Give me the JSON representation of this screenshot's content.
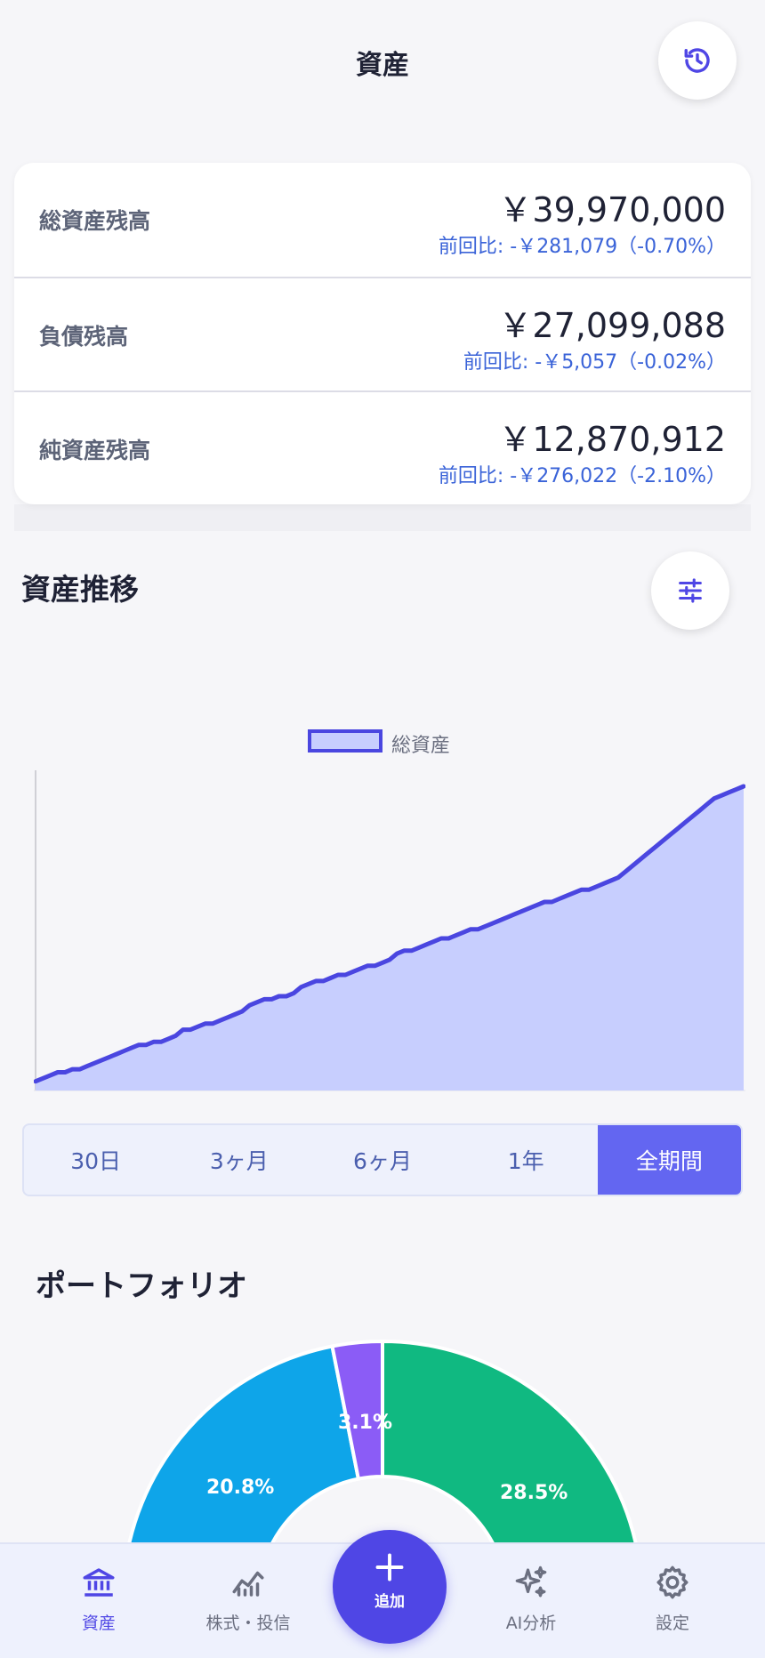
{
  "header": {
    "title": "資産"
  },
  "summary": {
    "rows": [
      {
        "label": "総資産残高",
        "value": "￥39,970,000",
        "change": "前回比: -￥281,079（-0.70%）"
      },
      {
        "label": "負債残高",
        "value": "￥27,099,088",
        "change": "前回比: -￥5,057（-0.02%）"
      },
      {
        "label": "純資産残高",
        "value": "￥12,870,912",
        "change": "前回比: -￥276,022（-2.10%）"
      }
    ]
  },
  "trend": {
    "title": "資産推移",
    "legend_label": "総資産",
    "periods": [
      "30日",
      "3ヶ月",
      "6ヶ月",
      "1年",
      "全期間"
    ],
    "selected_period": "全期間"
  },
  "chart_data": {
    "type": "area",
    "series": [
      {
        "name": "総資産",
        "values": [
          3,
          4,
          5,
          6,
          6,
          7,
          7,
          8,
          9,
          10,
          11,
          12,
          13,
          14,
          15,
          15,
          16,
          16,
          17,
          18,
          20,
          20,
          21,
          22,
          22,
          23,
          24,
          25,
          26,
          28,
          29,
          30,
          30,
          31,
          31,
          32,
          34,
          35,
          36,
          36,
          37,
          38,
          38,
          39,
          40,
          41,
          41,
          42,
          43,
          45,
          46,
          46,
          47,
          48,
          49,
          50,
          50,
          51,
          52,
          53,
          53,
          54,
          55,
          56,
          57,
          58,
          59,
          60,
          61,
          62,
          62,
          63,
          64,
          65,
          66,
          66,
          67,
          68,
          69,
          70,
          72,
          74,
          76,
          78,
          80,
          82,
          84,
          86,
          88,
          90,
          92,
          94,
          96,
          97,
          98,
          99,
          100
        ]
      }
    ],
    "colors": {
      "line": "#4a46e0",
      "fill": "#c7cefe"
    }
  },
  "portfolio": {
    "title": "ポートフォリオ",
    "slices": [
      {
        "label": "28.5%",
        "value": 28.5,
        "color": "#10b981"
      },
      {
        "label": "20.8%",
        "value": 20.8,
        "color": "#0ea5e9"
      },
      {
        "label": "3.1%",
        "value": 3.1,
        "color": "#8b5cf6"
      }
    ]
  },
  "tabbar": {
    "items": [
      {
        "label": "資産",
        "icon": "bank-icon",
        "active": true
      },
      {
        "label": "株式・投信",
        "icon": "stock-chart-icon",
        "active": false
      },
      {
        "label": "AI分析",
        "icon": "sparkles-icon",
        "active": false
      },
      {
        "label": "設定",
        "icon": "gear-icon",
        "active": false
      }
    ],
    "fab_label": "追加"
  },
  "colors": {
    "accent": "#4f46e5",
    "period_active": "#6366f1",
    "change_text": "#3a63d8"
  }
}
